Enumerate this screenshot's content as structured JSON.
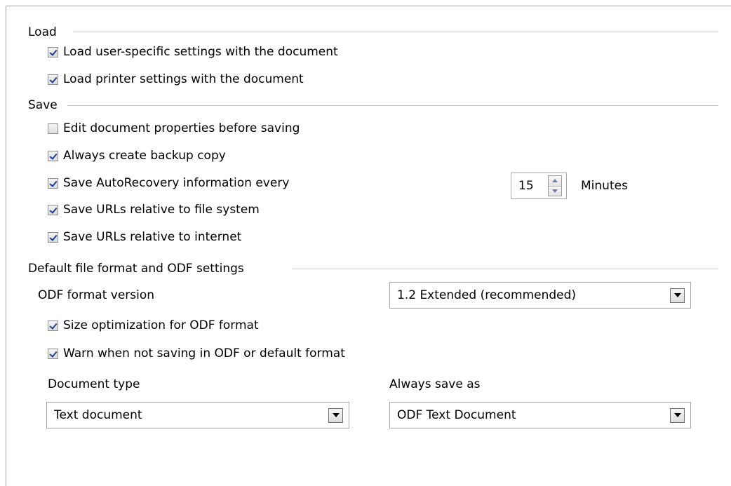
{
  "load": {
    "title": "Load",
    "items": [
      {
        "label": "Load user-specific settings with the document",
        "checked": true
      },
      {
        "label": "Load printer settings with the document",
        "checked": true
      }
    ]
  },
  "save": {
    "title": "Save",
    "items": [
      {
        "label": "Edit document properties before saving",
        "checked": false
      },
      {
        "label": "Always create backup copy",
        "checked": true
      },
      {
        "label": "Save AutoRecovery information every",
        "checked": true
      },
      {
        "label": "Save URLs relative to file system",
        "checked": true
      },
      {
        "label": "Save URLs relative to internet",
        "checked": true
      }
    ],
    "autorecovery": {
      "value": "15",
      "unit": "Minutes"
    }
  },
  "odf": {
    "title": "Default file format and ODF settings",
    "version_label": "ODF format version",
    "version_value": "1.2 Extended (recommended)",
    "items": [
      {
        "label": "Size optimization for ODF format",
        "checked": true
      },
      {
        "label": "Warn when not saving in ODF or default format",
        "checked": true
      }
    ],
    "doc_type_label": "Document type",
    "doc_type_value": "Text document",
    "save_as_label": "Always save as",
    "save_as_value": "ODF Text Document"
  }
}
